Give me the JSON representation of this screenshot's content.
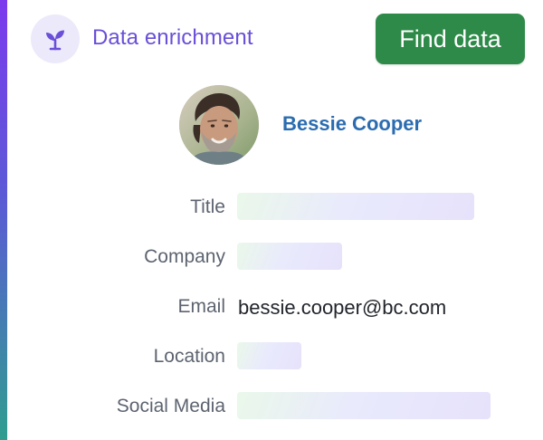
{
  "header": {
    "title": "Data enrichment",
    "icon": "sprout-icon",
    "action_label": "Find data"
  },
  "profile": {
    "name": "Bessie Cooper"
  },
  "fields": {
    "title_label": "Title",
    "company_label": "Company",
    "email_label": "Email",
    "email_value": "bessie.cooper@bc.com",
    "location_label": "Location",
    "social_label": "Social Media"
  },
  "colors": {
    "accent": "#6a4fd8",
    "button": "#2e8a49",
    "name": "#2b6cb0"
  }
}
